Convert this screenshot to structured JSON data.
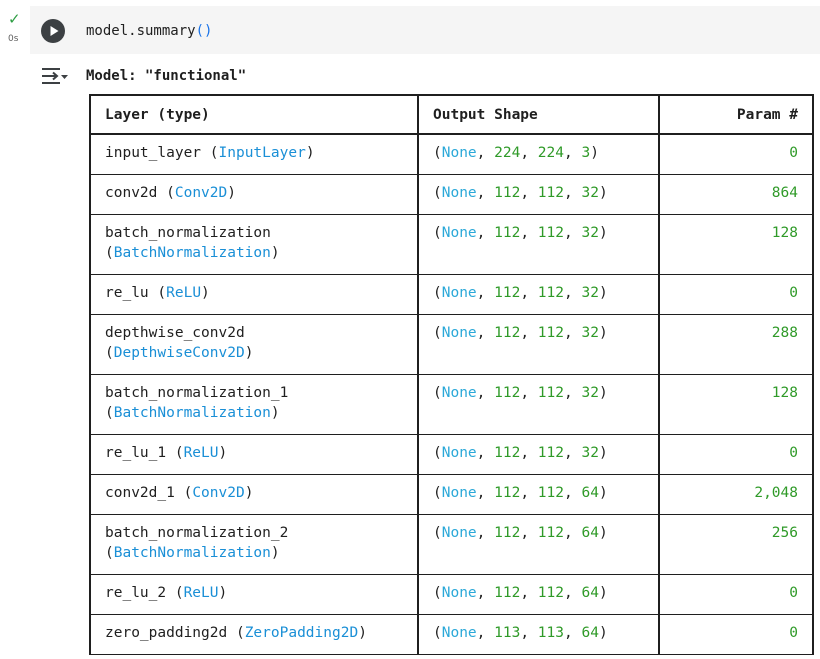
{
  "cell": {
    "exec_status_icon": "check-icon",
    "exec_time": "0s",
    "code_prefix": "model.summary",
    "code_parens": "()"
  },
  "output": {
    "toggle_icon": "output-toggle-icon",
    "title": "Model: \"functional\""
  },
  "table": {
    "headers": [
      "Layer (type)",
      "Output Shape",
      "Param #"
    ],
    "rows": [
      {
        "name": "input_layer",
        "type": "InputLayer",
        "wrap": false,
        "shape": [
          "None",
          "224",
          "224",
          "3"
        ],
        "params": "0"
      },
      {
        "name": "conv2d",
        "type": "Conv2D",
        "wrap": false,
        "shape": [
          "None",
          "112",
          "112",
          "32"
        ],
        "params": "864"
      },
      {
        "name": "batch_normalization",
        "type": "BatchNormalization",
        "wrap": true,
        "shape": [
          "None",
          "112",
          "112",
          "32"
        ],
        "params": "128"
      },
      {
        "name": "re_lu",
        "type": "ReLU",
        "wrap": false,
        "shape": [
          "None",
          "112",
          "112",
          "32"
        ],
        "params": "0"
      },
      {
        "name": "depthwise_conv2d",
        "type": "DepthwiseConv2D",
        "wrap": true,
        "shape": [
          "None",
          "112",
          "112",
          "32"
        ],
        "params": "288"
      },
      {
        "name": "batch_normalization_1",
        "type": "BatchNormalization",
        "wrap": true,
        "shape": [
          "None",
          "112",
          "112",
          "32"
        ],
        "params": "128"
      },
      {
        "name": "re_lu_1",
        "type": "ReLU",
        "wrap": false,
        "shape": [
          "None",
          "112",
          "112",
          "32"
        ],
        "params": "0"
      },
      {
        "name": "conv2d_1",
        "type": "Conv2D",
        "wrap": false,
        "shape": [
          "None",
          "112",
          "112",
          "64"
        ],
        "params": "2,048"
      },
      {
        "name": "batch_normalization_2",
        "type": "BatchNormalization",
        "wrap": true,
        "shape": [
          "None",
          "112",
          "112",
          "64"
        ],
        "params": "256"
      },
      {
        "name": "re_lu_2",
        "type": "ReLU",
        "wrap": false,
        "shape": [
          "None",
          "112",
          "112",
          "64"
        ],
        "params": "0"
      },
      {
        "name": "zero_padding2d",
        "type": "ZeroPadding2D",
        "wrap": false,
        "shape": [
          "None",
          "113",
          "113",
          "64"
        ],
        "params": "0"
      }
    ]
  }
}
